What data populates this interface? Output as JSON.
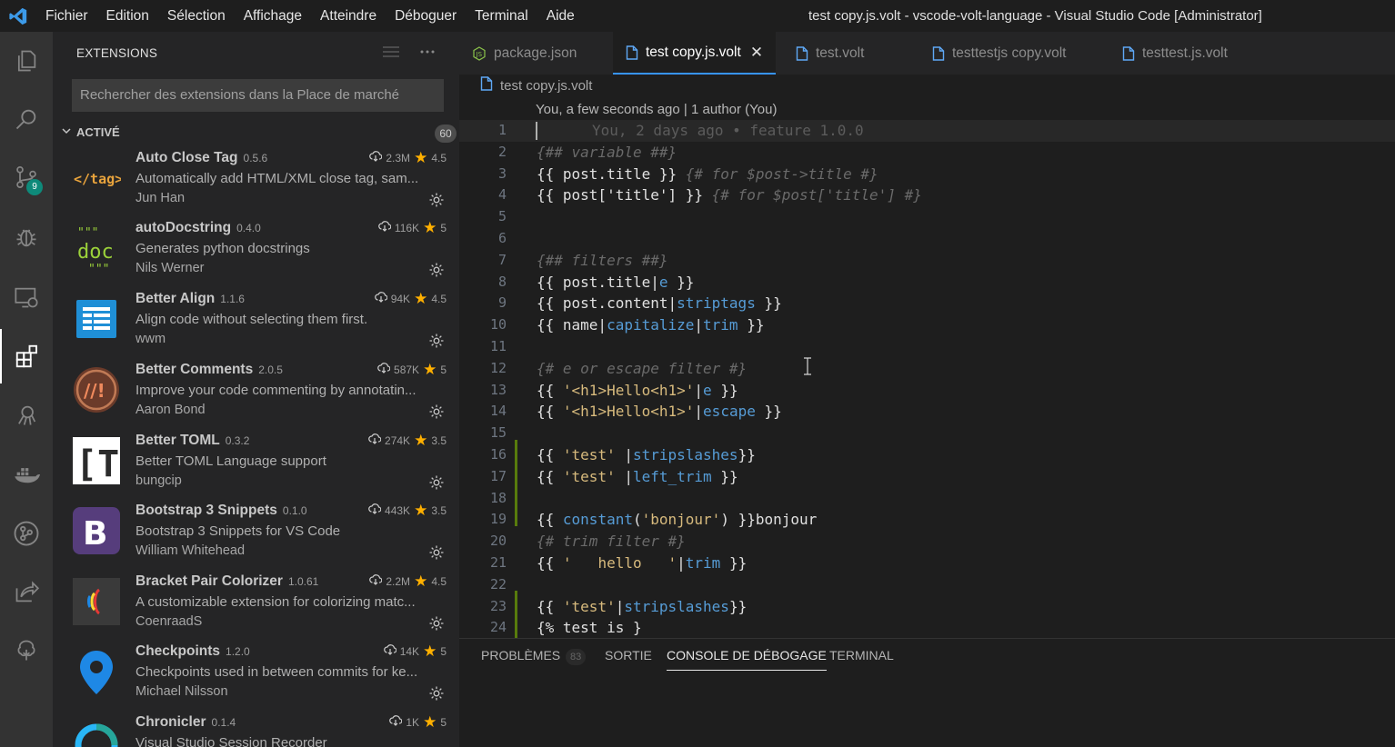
{
  "titlebar": {
    "menu": [
      "Fichier",
      "Edition",
      "Sélection",
      "Affichage",
      "Atteindre",
      "Déboguer",
      "Terminal",
      "Aide"
    ],
    "window_title": "test copy.js.volt - vscode-volt-language - Visual Studio Code [Administrator]"
  },
  "activity_bar": {
    "source_control_badge": "9"
  },
  "sidebar": {
    "title": "EXTENSIONS",
    "search_placeholder": "Rechercher des extensions dans la Place de marché",
    "section_label": "ACTIVÉ",
    "section_count": "60",
    "extensions": [
      {
        "name": "Auto Close Tag",
        "version": "0.5.6",
        "downloads": "2.3M",
        "rating": "4.5",
        "description": "Automatically add HTML/XML close tag, sam...",
        "author": "Jun Han",
        "icon": "tag-icon"
      },
      {
        "name": "autoDocstring",
        "version": "0.4.0",
        "downloads": "116K",
        "rating": "5",
        "description": "Generates python docstrings",
        "author": "Nils Werner",
        "icon": "docstring-icon"
      },
      {
        "name": "Better Align",
        "version": "1.1.6",
        "downloads": "94K",
        "rating": "4.5",
        "description": "Align code without selecting them first.",
        "author": "wwm",
        "icon": "align-icon"
      },
      {
        "name": "Better Comments",
        "version": "2.0.5",
        "downloads": "587K",
        "rating": "5",
        "description": "Improve your code commenting by annotatin...",
        "author": "Aaron Bond",
        "icon": "comments-icon"
      },
      {
        "name": "Better TOML",
        "version": "0.3.2",
        "downloads": "274K",
        "rating": "3.5",
        "description": "Better TOML Language support",
        "author": "bungcip",
        "icon": "toml-icon"
      },
      {
        "name": "Bootstrap 3 Snippets",
        "version": "0.1.0",
        "downloads": "443K",
        "rating": "3.5",
        "description": "Bootstrap 3 Snippets for VS Code",
        "author": "William Whitehead",
        "icon": "bootstrap-icon"
      },
      {
        "name": "Bracket Pair Colorizer",
        "version": "1.0.61",
        "downloads": "2.2M",
        "rating": "4.5",
        "description": "A customizable extension for colorizing matc...",
        "author": "CoenraadS",
        "icon": "bracket-icon"
      },
      {
        "name": "Checkpoints",
        "version": "1.2.0",
        "downloads": "14K",
        "rating": "5",
        "description": "Checkpoints used in between commits for ke...",
        "author": "Michael Nilsson",
        "icon": "map-pin-icon"
      },
      {
        "name": "Chronicler",
        "version": "0.1.4",
        "downloads": "1K",
        "rating": "5",
        "description": "Visual Studio Session Recorder",
        "author": "",
        "icon": "chronicler-icon"
      }
    ]
  },
  "tabs": [
    {
      "label": "package.json",
      "active": false
    },
    {
      "label": "test copy.js.volt",
      "active": true
    },
    {
      "label": "test.volt",
      "active": false
    },
    {
      "label": "testtestjs copy.volt",
      "active": false
    },
    {
      "label": "testtest.js.volt",
      "active": false
    }
  ],
  "breadcrumb": "test copy.js.volt",
  "codelens": "You, a few seconds ago | 1 author (You)",
  "editor": {
    "line_numbers": [
      "1",
      "2",
      "3",
      "4",
      "5",
      "6",
      "7",
      "8",
      "9",
      "10",
      "11",
      "12",
      "13",
      "14",
      "15",
      "16",
      "17",
      "18",
      "19",
      "20",
      "21",
      "22",
      "23",
      "24"
    ],
    "blame_hint": "You, 2 days ago • feature 1.0.0"
  },
  "panel": {
    "tabs": [
      "PROBLÈMES",
      "SORTIE",
      "CONSOLE DE DÉBOGAGE",
      "TERMINAL"
    ],
    "problems_count": "83",
    "active_tab": "CONSOLE DE DÉBOGAGE"
  },
  "colors": {
    "comment": "#6a6a6a",
    "filter": "#569cd6",
    "string": "#ce9178",
    "string_green": "#d7ba7d",
    "accent": "#3794ff"
  }
}
